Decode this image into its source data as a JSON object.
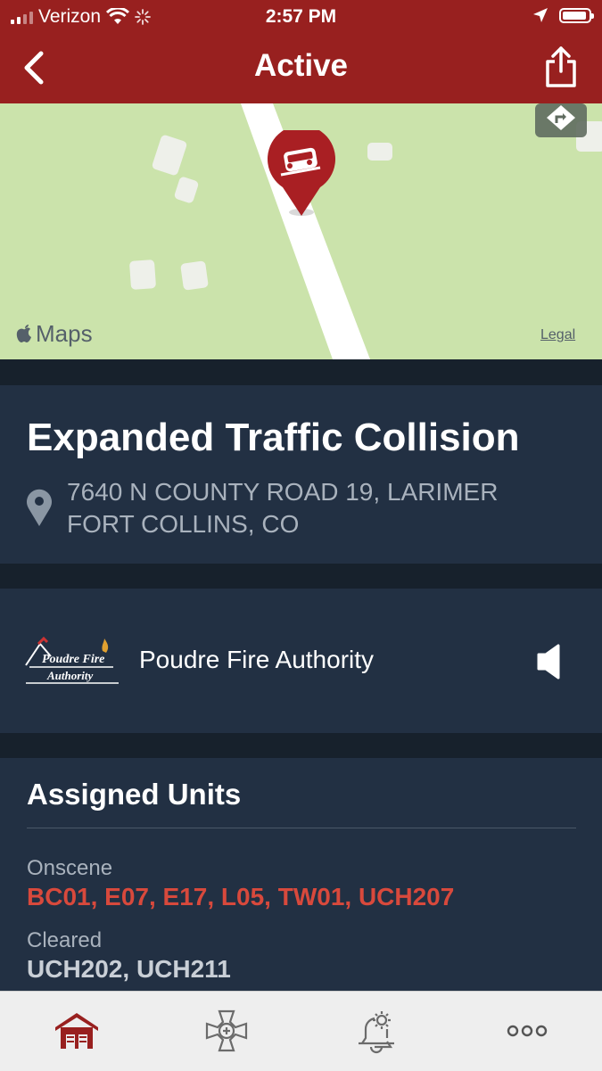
{
  "status_bar": {
    "carrier": "Verizon",
    "time": "2:57 PM"
  },
  "nav": {
    "title": "Active"
  },
  "map": {
    "brand": "Maps",
    "legal": "Legal",
    "incident_icon": "car-crash-icon"
  },
  "incident": {
    "title": "Expanded Traffic Collision",
    "address_line1": "7640 N COUNTY ROAD 19, LARIMER",
    "address_line2": "FORT COLLINS, CO"
  },
  "agency": {
    "name": "Poudre Fire Authority",
    "logo_text_1": "Poudre Fire",
    "logo_text_2": "Authority"
  },
  "units": {
    "title": "Assigned Units",
    "groups": [
      {
        "label": "Onscene",
        "value": "BC01, E07, E17, L05, TW01, UCH207",
        "color": "#d8493c"
      },
      {
        "label": "Cleared",
        "value": "UCH202, UCH211",
        "color": "#c9cfd6"
      }
    ]
  },
  "tabs": [
    {
      "name": "stations",
      "icon": "firehouse-icon",
      "active": true
    },
    {
      "name": "agencies",
      "icon": "maltese-cross-icon",
      "active": false
    },
    {
      "name": "alerts",
      "icon": "bell-gear-icon",
      "active": false
    },
    {
      "name": "more",
      "icon": "more-icon",
      "active": false
    }
  ],
  "colors": {
    "brand": "#98201f",
    "panel": "#223043",
    "onscene": "#d8493c"
  }
}
